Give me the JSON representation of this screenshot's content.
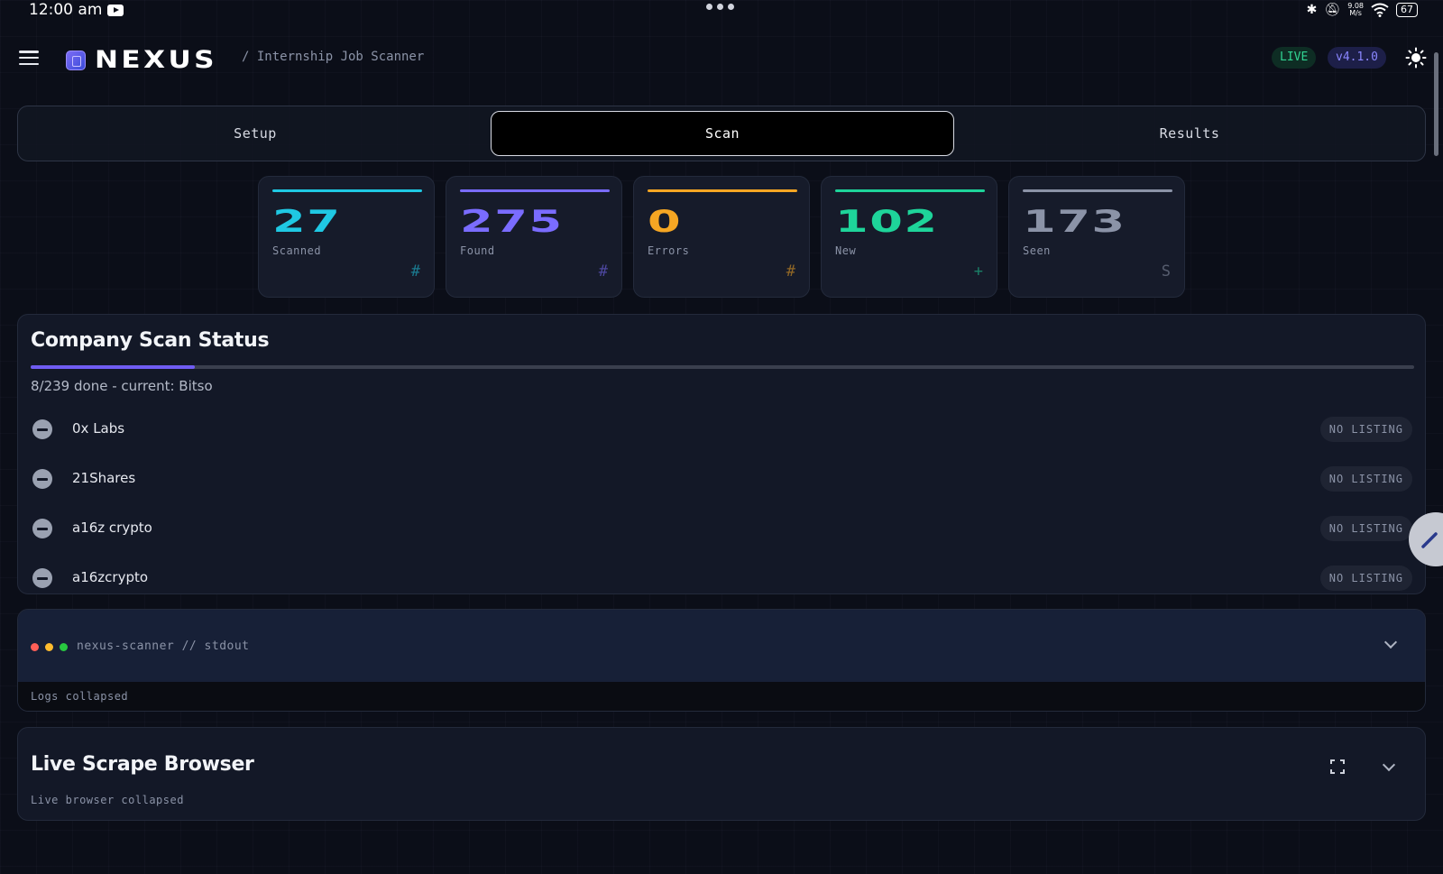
{
  "statusbar": {
    "time": "12:00 am",
    "speed_top": "9.08",
    "speed_bottom": "M/s",
    "battery": "67"
  },
  "header": {
    "brand": "NEXUS",
    "breadcrumb": "/ Internship Job Scanner",
    "live_badge": "LIVE",
    "version_badge": "v4.1.0"
  },
  "tabs": [
    {
      "label": "Setup",
      "active": false
    },
    {
      "label": "Scan",
      "active": true
    },
    {
      "label": "Results",
      "active": false
    }
  ],
  "stats": [
    {
      "value": "27",
      "label": "Scanned",
      "icon": "#",
      "color": "#1fc8e3"
    },
    {
      "value": "275",
      "label": "Found",
      "icon": "#",
      "color": "#7a6cff"
    },
    {
      "value": "0",
      "label": "Errors",
      "icon": "#",
      "color": "#f5a623"
    },
    {
      "value": "102",
      "label": "New",
      "icon": "+",
      "color": "#1ed49a"
    },
    {
      "value": "173",
      "label": "Seen",
      "icon": "S",
      "color": "#8b93a7"
    }
  ],
  "company_scan": {
    "title": "Company Scan Status",
    "progress_done": 8,
    "progress_total": 239,
    "progress_text": "8/239 done - current: Bitso",
    "companies": [
      {
        "name": "0x Labs",
        "status": "NO LISTING"
      },
      {
        "name": "21Shares",
        "status": "NO LISTING"
      },
      {
        "name": "a16z crypto",
        "status": "NO LISTING"
      },
      {
        "name": "a16zcrypto",
        "status": "NO LISTING"
      }
    ]
  },
  "stdout": {
    "title": "nexus-scanner // stdout",
    "body": "Logs collapsed"
  },
  "live_browser": {
    "title": "Live Scrape Browser",
    "body": "Live browser collapsed"
  },
  "colors": {
    "accent": "#6f5cf2",
    "live": "#31d392",
    "version": "#8a86ff"
  }
}
